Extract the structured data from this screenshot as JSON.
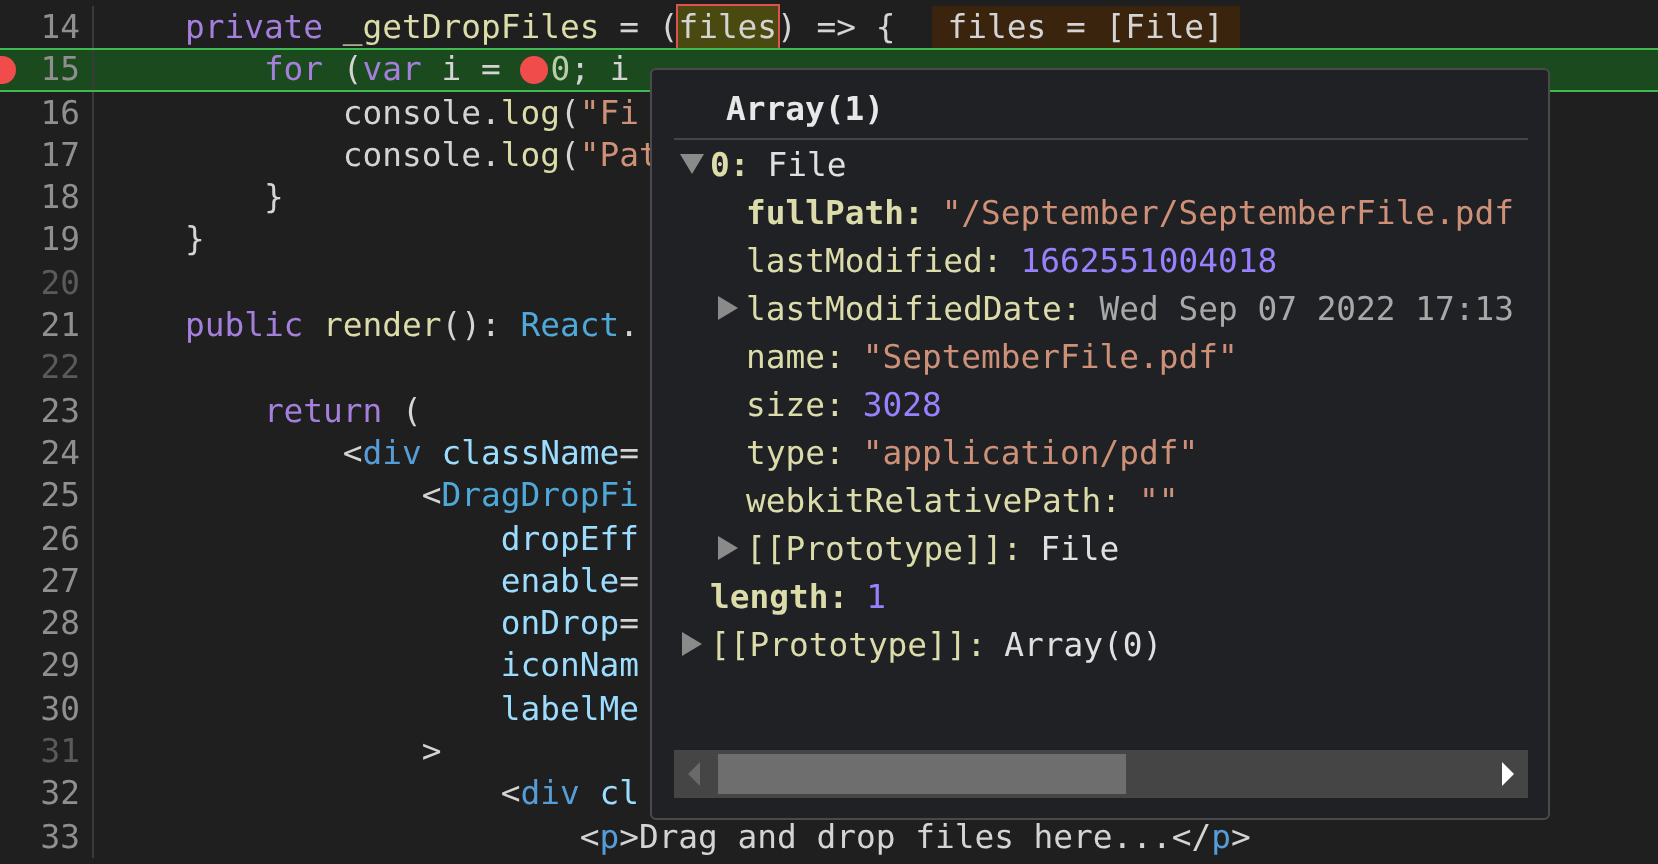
{
  "editor": {
    "lines": [
      {
        "number": "14",
        "current": false,
        "dim": false,
        "breakpoint": false,
        "tokens": [
          {
            "kind": "keyword",
            "text": "private "
          },
          {
            "kind": "func",
            "text": "_getDropFiles"
          },
          {
            "kind": "plain",
            "text": " = ("
          },
          {
            "kind": "plain",
            "text": "files",
            "highlighted": true
          },
          {
            "kind": "plain",
            "text": ") => {"
          },
          {
            "kind": "hint",
            "text": "files = [File]"
          }
        ],
        "children": [
          {
            "number": "15",
            "current": true,
            "dim": false,
            "breakpoint": true,
            "tokens": [
              {
                "kind": "keyword",
                "text": "for "
              },
              {
                "kind": "plain",
                "text": "("
              },
              {
                "kind": "keyword",
                "text": "var "
              },
              {
                "kind": "plain",
                "text": "i = "
              },
              {
                "kind": "breakpoint"
              },
              {
                "kind": "number",
                "text": "0"
              },
              {
                "kind": "plain",
                "text": "; i"
              }
            ],
            "children": [
              {
                "number": "16",
                "current": false,
                "dim": false,
                "breakpoint": false,
                "tokens": [
                  {
                    "kind": "plain",
                    "text": "console."
                  },
                  {
                    "kind": "func",
                    "text": "log"
                  },
                  {
                    "kind": "plain",
                    "text": "("
                  },
                  {
                    "kind": "string",
                    "text": "\"Fi"
                  }
                ]
              },
              {
                "number": "17",
                "current": false,
                "dim": false,
                "breakpoint": false,
                "tokens": [
                  {
                    "kind": "plain",
                    "text": "console."
                  },
                  {
                    "kind": "func",
                    "text": "log"
                  },
                  {
                    "kind": "plain",
                    "text": "("
                  },
                  {
                    "kind": "string",
                    "text": "\"Pat"
                  }
                ]
              }
            ]
          },
          {
            "number": "18",
            "current": false,
            "dim": false,
            "breakpoint": false,
            "tokens": [
              {
                "kind": "plain",
                "text": "}"
              }
            ]
          }
        ]
      },
      {
        "number": "19",
        "current": false,
        "dim": false,
        "breakpoint": false,
        "tokens": [
          {
            "kind": "plain",
            "text": "}"
          }
        ]
      },
      {
        "number": "20",
        "current": false,
        "dim": true,
        "breakpoint": false
      },
      {
        "number": "21",
        "current": false,
        "dim": false,
        "breakpoint": false,
        "tokens": [
          {
            "kind": "keyword",
            "text": "public "
          },
          {
            "kind": "func",
            "text": "render"
          },
          {
            "kind": "plain",
            "text": "(): "
          },
          {
            "kind": "type",
            "text": "React"
          },
          {
            "kind": "plain",
            "text": "."
          }
        ],
        "children": [
          {
            "number": "22",
            "current": false,
            "dim": true,
            "breakpoint": false
          },
          {
            "number": "23",
            "current": false,
            "dim": false,
            "breakpoint": false,
            "tokens": [
              {
                "kind": "keyword",
                "text": "return "
              },
              {
                "kind": "plain",
                "text": "("
              }
            ],
            "children": [
              {
                "number": "24",
                "current": false,
                "dim": false,
                "breakpoint": false,
                "tokens": [
                  {
                    "kind": "plain",
                    "text": "<"
                  },
                  {
                    "kind": "tag",
                    "text": "div "
                  },
                  {
                    "kind": "attr",
                    "text": "className"
                  },
                  {
                    "kind": "plain",
                    "text": "="
                  }
                ],
                "children": [
                  {
                    "number": "25",
                    "current": false,
                    "dim": false,
                    "breakpoint": false,
                    "tokens": [
                      {
                        "kind": "plain",
                        "text": "<"
                      },
                      {
                        "kind": "type",
                        "text": "DragDropFi"
                      }
                    ],
                    "children": [
                      {
                        "number": "26",
                        "current": false,
                        "dim": false,
                        "breakpoint": false,
                        "tokens": [
                          {
                            "kind": "attr",
                            "text": "dropEff"
                          }
                        ]
                      },
                      {
                        "number": "27",
                        "current": false,
                        "dim": false,
                        "breakpoint": false,
                        "tokens": [
                          {
                            "kind": "attr",
                            "text": "enable"
                          },
                          {
                            "kind": "plain",
                            "text": "="
                          }
                        ]
                      },
                      {
                        "number": "28",
                        "current": false,
                        "dim": false,
                        "breakpoint": false,
                        "tokens": [
                          {
                            "kind": "attr",
                            "text": "onDrop"
                          },
                          {
                            "kind": "plain",
                            "text": "="
                          }
                        ]
                      },
                      {
                        "number": "29",
                        "current": false,
                        "dim": false,
                        "breakpoint": false,
                        "tokens": [
                          {
                            "kind": "attr",
                            "text": "iconNam"
                          }
                        ]
                      },
                      {
                        "number": "30",
                        "current": false,
                        "dim": false,
                        "breakpoint": false,
                        "tokens": [
                          {
                            "kind": "attr",
                            "text": "labelMe"
                          }
                        ]
                      }
                    ]
                  },
                  {
                    "number": "31",
                    "current": false,
                    "dim": true,
                    "breakpoint": false,
                    "tokens": [
                      {
                        "kind": "plain",
                        "text": ">"
                      }
                    ],
                    "children": [
                      {
                        "number": "32",
                        "current": false,
                        "dim": false,
                        "breakpoint": false,
                        "tokens": [
                          {
                            "kind": "plain",
                            "text": "<"
                          },
                          {
                            "kind": "tag",
                            "text": "div "
                          },
                          {
                            "kind": "attr",
                            "text": "cl"
                          }
                        ],
                        "children": [
                          {
                            "number": "33",
                            "current": false,
                            "dim": false,
                            "breakpoint": false,
                            "tokens": [
                              {
                                "kind": "plain",
                                "text": "<"
                              },
                              {
                                "kind": "tag",
                                "text": "p"
                              },
                              {
                                "kind": "plain",
                                "text": ">Drag and drop files here...</"
                              },
                              {
                                "kind": "tag",
                                "text": "p"
                              },
                              {
                                "kind": "plain",
                                "text": ">"
                              }
                            ]
                          }
                        ]
                      }
                    ]
                  }
                ]
              }
            ]
          }
        ]
      }
    ]
  },
  "hover": {
    "title": "Array(1)",
    "rows": [
      {
        "key": "0:",
        "bold": true,
        "value": "File",
        "kind": "object",
        "expanded": true,
        "children": [
          {
            "key": "fullPath:",
            "bold": true,
            "value": "\"/September/SeptemberFile.pdf",
            "kind": "string"
          },
          {
            "key": "lastModified:",
            "bold": false,
            "value": "1662551004018",
            "kind": "number"
          },
          {
            "key": "lastModifiedDate:",
            "bold": false,
            "value": "Wed Sep 07 2022 17:13",
            "kind": "date",
            "expanded": false
          },
          {
            "key": "name:",
            "bold": false,
            "value": "\"SeptemberFile.pdf\"",
            "kind": "string"
          },
          {
            "key": "size:",
            "bold": false,
            "value": "3028",
            "kind": "number"
          },
          {
            "key": "type:",
            "bold": false,
            "value": "\"application/pdf\"",
            "kind": "string"
          },
          {
            "key": "webkitRelativePath:",
            "bold": false,
            "value": "\"\"",
            "kind": "string"
          },
          {
            "key": "[[Prototype]]:",
            "bold": false,
            "value": "File",
            "kind": "object",
            "expanded": false
          }
        ]
      },
      {
        "key": "length:",
        "bold": true,
        "value": "1",
        "kind": "number"
      },
      {
        "key": "[[Prototype]]:",
        "bold": false,
        "value": "Array(0)",
        "kind": "object",
        "expanded": false
      }
    ]
  }
}
